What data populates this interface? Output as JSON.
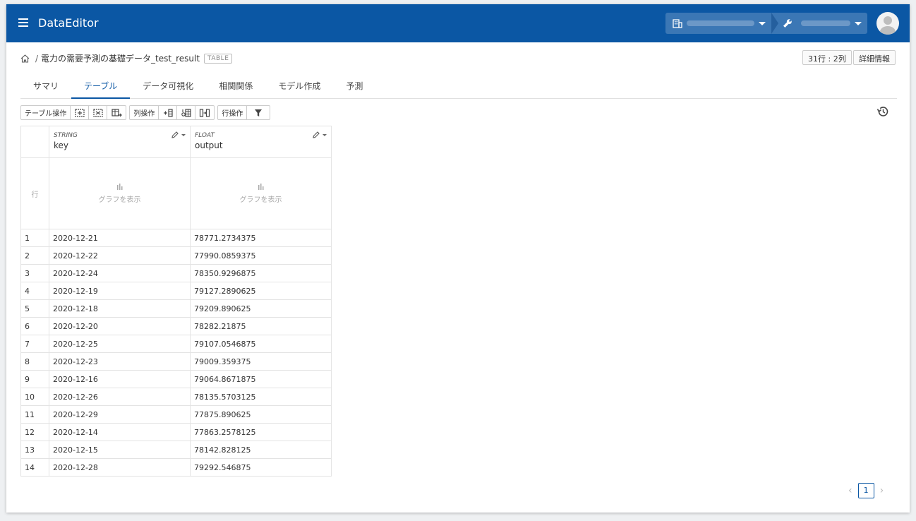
{
  "header": {
    "app_title": "DataEditor"
  },
  "breadcrumb": {
    "separator": "/",
    "table_name": "電力の需要予測の基礎データ_test_result",
    "badge": "TABLE"
  },
  "info": {
    "size_label": "31行 : 2列",
    "details_label": "詳細情報"
  },
  "tabs": [
    {
      "label": "サマリ",
      "active": false
    },
    {
      "label": "テーブル",
      "active": true
    },
    {
      "label": "データ可視化",
      "active": false
    },
    {
      "label": "相関関係",
      "active": false
    },
    {
      "label": "モデル作成",
      "active": false
    },
    {
      "label": "予測",
      "active": false
    }
  ],
  "toolbar": {
    "table_ops": "テーブル操作",
    "column_ops": "列操作",
    "row_ops": "行操作"
  },
  "grid": {
    "row_header": "行",
    "show_chart": "グラフを表示",
    "columns": [
      {
        "type": "STRING",
        "name": "key"
      },
      {
        "type": "FLOAT",
        "name": "output"
      }
    ],
    "rows": [
      {
        "n": "1",
        "key": "2020-12-21",
        "output": "78771.2734375"
      },
      {
        "n": "2",
        "key": "2020-12-22",
        "output": "77990.0859375"
      },
      {
        "n": "3",
        "key": "2020-12-24",
        "output": "78350.9296875"
      },
      {
        "n": "4",
        "key": "2020-12-19",
        "output": "79127.2890625"
      },
      {
        "n": "5",
        "key": "2020-12-18",
        "output": "79209.890625"
      },
      {
        "n": "6",
        "key": "2020-12-20",
        "output": "78282.21875"
      },
      {
        "n": "7",
        "key": "2020-12-25",
        "output": "79107.0546875"
      },
      {
        "n": "8",
        "key": "2020-12-23",
        "output": "79009.359375"
      },
      {
        "n": "9",
        "key": "2020-12-16",
        "output": "79064.8671875"
      },
      {
        "n": "10",
        "key": "2020-12-26",
        "output": "78135.5703125"
      },
      {
        "n": "11",
        "key": "2020-12-29",
        "output": "77875.890625"
      },
      {
        "n": "12",
        "key": "2020-12-14",
        "output": "77863.2578125"
      },
      {
        "n": "13",
        "key": "2020-12-15",
        "output": "78142.828125"
      },
      {
        "n": "14",
        "key": "2020-12-28",
        "output": "79292.546875"
      }
    ]
  },
  "pagination": {
    "current_page": "1",
    "prev": "‹",
    "next": "›"
  },
  "colors": {
    "brand": "#0b57a4"
  }
}
